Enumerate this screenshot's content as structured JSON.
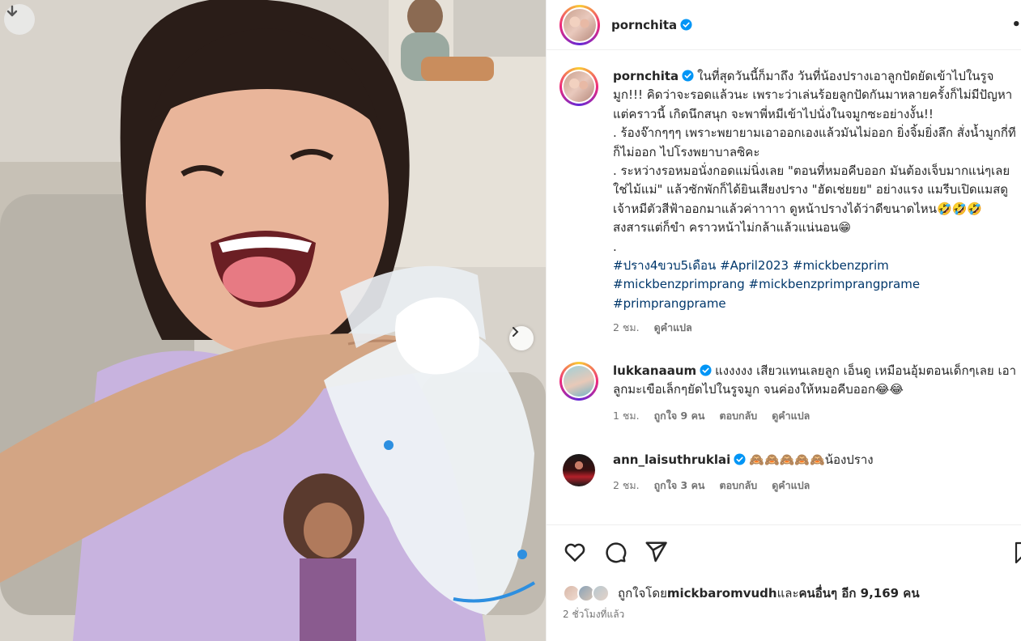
{
  "post": {
    "author": "pornchita",
    "more_icon": "more-horizontal-icon",
    "download_icon": "download-icon",
    "next_icon": "chevron-right-icon"
  },
  "caption": {
    "username": "pornchita",
    "text": "ในที่สุดวันนี้ก็มาถึง วันที่น้องปรางเอาลูกปัดยัดเข้าไปในรูจมูก!!! คิดว่าจะรอดแล้วนะ เพราะว่าเล่นร้อยลูกปัดกันมาหลายครั้งก็ไม่มีปัญหา แต่คราวนี้ เกิดนึกสนุก จะพาพี่หมีเข้าไปนั่งในจมูกซะอย่างงั้น!!\n. ร้องจ๊ากๆๆๆ เพราะพยายามเอาออกเองแล้วมันไม่ออก ยิ่งจิ้มยิ่งลึก สั่งน้ำมูกกี่ทีก็ไม่ออก ไปโรงพยาบาลซิคะ\n. ระหว่างรอหมอนั่งกอดแม่นิ่งเลย \"ตอนที่หมอคีบออก มันต้องเจ็บมากแน่ๆเลยใช่ไม้แม่\" แล้วซักพักก็ได้ยินเสียงปราง \"ฮัดเช่ยยย\" อย่างแรง แมรีบเปิดแมสดู เจ้าหมีตัวสีฟ้าออกมาแล้วค่าาาาา ดูหน้าปรางได้ว่าดีขนาดไหน🤣🤣🤣 สงสารแต่ก็ขำ คราวหน้าไม่กล้าแล้วแน่นอน😁\n.",
    "hashtags_line1": "#ปราง4ขวบ5เดือน #April2023 #mickbenzprim",
    "hashtags_line2": "#mickbenzprimprang #mickbenzprimprangprame",
    "hashtags_line3": "#primprangprame",
    "time": "2 ชม.",
    "translate": "ดูคำแปล"
  },
  "comments": [
    {
      "username": "lukkanaaum",
      "text": "แงงงงง เสียวแทนเลยลูก เอ็นดู เหมือนอุ้มตอนเด็กๆเลย เอาลูกมะเขือเล็กๆยัดไปในรูจมูก จนค่องให้หมอคีบออก😂😂",
      "time": "1 ชม.",
      "likes": "ถูกใจ 9 คน",
      "reply": "ตอบกลับ",
      "translate": "ดูคำแปล"
    },
    {
      "username": "ann_laisuthruklai",
      "text": "🙈🙈🙈🙈🙈น้องปราง",
      "time": "2 ชม.",
      "likes": "ถูกใจ 3 คน",
      "reply": "ตอบกลับ",
      "translate": "ดูคำแปล"
    }
  ],
  "actions": {
    "like_icon": "heart-icon",
    "comment_icon": "comment-icon",
    "share_icon": "send-icon",
    "save_icon": "bookmark-icon"
  },
  "likes": {
    "prefix": "ถูกใจโดย ",
    "user": "mickbaromvudh",
    "middle": " และ",
    "others": "คนอื่นๆ อีก 9,169 คน"
  },
  "posted_ago": "2 ชั่วโมงที่แล้ว",
  "colors": {
    "link": "#00376b",
    "verified": "#0095f6",
    "muted": "#737373"
  }
}
